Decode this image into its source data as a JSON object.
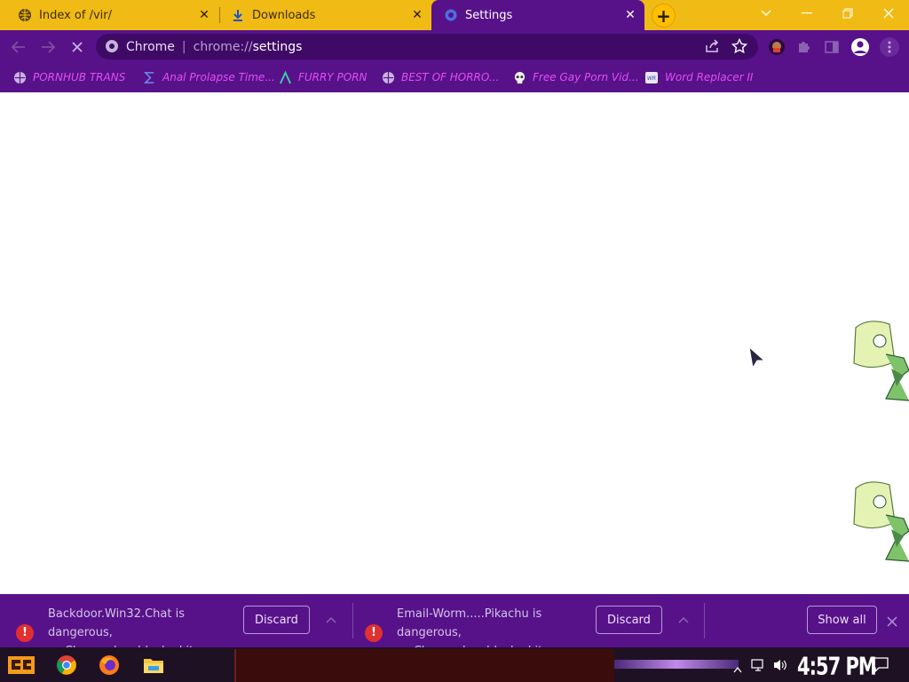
{
  "tabs": [
    {
      "title": "Index of /vir/",
      "icon": "globe-icon",
      "active": false
    },
    {
      "title": "Downloads",
      "icon": "download-icon",
      "active": false
    },
    {
      "title": "Settings",
      "icon": "settings-gear-icon",
      "active": true
    }
  ],
  "omnibox": {
    "site_label": "Chrome",
    "url_scheme": "chrome://",
    "url_path": "settings"
  },
  "bookmarks": [
    {
      "label": "PORNHUB TRANS",
      "icon": "globe-icon"
    },
    {
      "label": "Anal Prolapse Time...",
      "icon": "sigma-icon"
    },
    {
      "label": "FURRY PORN",
      "icon": "lambda-icon"
    },
    {
      "label": "BEST OF HORRO...",
      "icon": "globe-icon"
    },
    {
      "label": "Free Gay Porn Vid...",
      "icon": "skull-icon"
    },
    {
      "label": "Word Replacer II",
      "icon": "word-replacer-icon"
    }
  ],
  "downloads": [
    {
      "line1": "Backdoor.Win32.Chat is dangerous,",
      "line2": "so Chrome has blocked it.",
      "action": "Discard"
    },
    {
      "line1": "Email-Worm.....Pikachu is dangerous,",
      "line2": "so Chrome has blocked it.",
      "action": "Discard"
    }
  ],
  "shelf": {
    "show_all_label": "Show all"
  },
  "taskbar": {
    "clock": "4:57 PM"
  },
  "colors": {
    "tabstrip": "#f0bb14",
    "theme_purple": "#57128a",
    "bookmark_text": "#e34df2",
    "danger": "#e03030"
  }
}
